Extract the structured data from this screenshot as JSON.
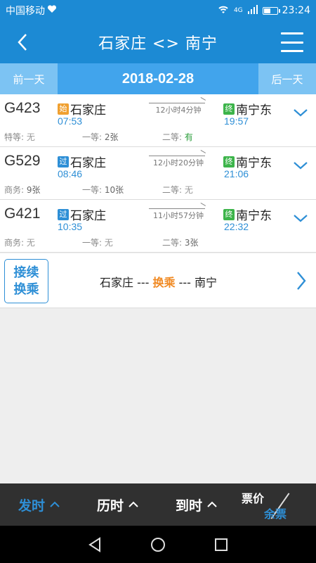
{
  "status": {
    "carrier": "中国移动",
    "network": "4G",
    "time": "23:24"
  },
  "header": {
    "title": "石家庄 <> 南宁"
  },
  "date_bar": {
    "prev_label": "前一天",
    "date": "2018-02-28",
    "next_label": "后一天"
  },
  "trains": [
    {
      "number": "G423",
      "from_tag": "始",
      "from": "石家庄",
      "dep_time": "07:53",
      "duration": "12小时4分钟",
      "to_tag": "终",
      "to": "南宁东",
      "arr_time": "19:57",
      "seats": [
        {
          "label": "特等: ",
          "value": "无"
        },
        {
          "label": "一等: ",
          "value": "2张"
        },
        {
          "label": "二等: ",
          "value": "有"
        }
      ]
    },
    {
      "number": "G529",
      "from_tag": "过",
      "from": "石家庄",
      "dep_time": "08:46",
      "duration": "12小时20分钟",
      "to_tag": "终",
      "to": "南宁东",
      "arr_time": "21:06",
      "seats": [
        {
          "label": "商务: ",
          "value": "9张"
        },
        {
          "label": "一等: ",
          "value": "10张"
        },
        {
          "label": "二等: ",
          "value": "无"
        }
      ]
    },
    {
      "number": "G421",
      "from_tag": "过",
      "from": "石家庄",
      "dep_time": "10:35",
      "duration": "11小时57分钟",
      "to_tag": "终",
      "to": "南宁东",
      "arr_time": "22:32",
      "seats": [
        {
          "label": "商务: ",
          "value": "无"
        },
        {
          "label": "一等: ",
          "value": "无"
        },
        {
          "label": "二等: ",
          "value": "3张"
        }
      ]
    }
  ],
  "transfer": {
    "badge_line1": "接续",
    "badge_line2": "换乘",
    "from": "石家庄",
    "sep1": " --- ",
    "middle": "换乘",
    "sep2": " --- ",
    "to": "南宁"
  },
  "sort_bar": {
    "depart": "发时",
    "duration": "历时",
    "arrive": "到时",
    "price": "票价",
    "remaining": "余票"
  },
  "colors": {
    "primary": "#1c8ad4",
    "date_bar": "#41a4ec",
    "accent_blue": "#2e8fd6",
    "highlight_orange": "#f08a24",
    "available_green": "#2a9d3a"
  }
}
